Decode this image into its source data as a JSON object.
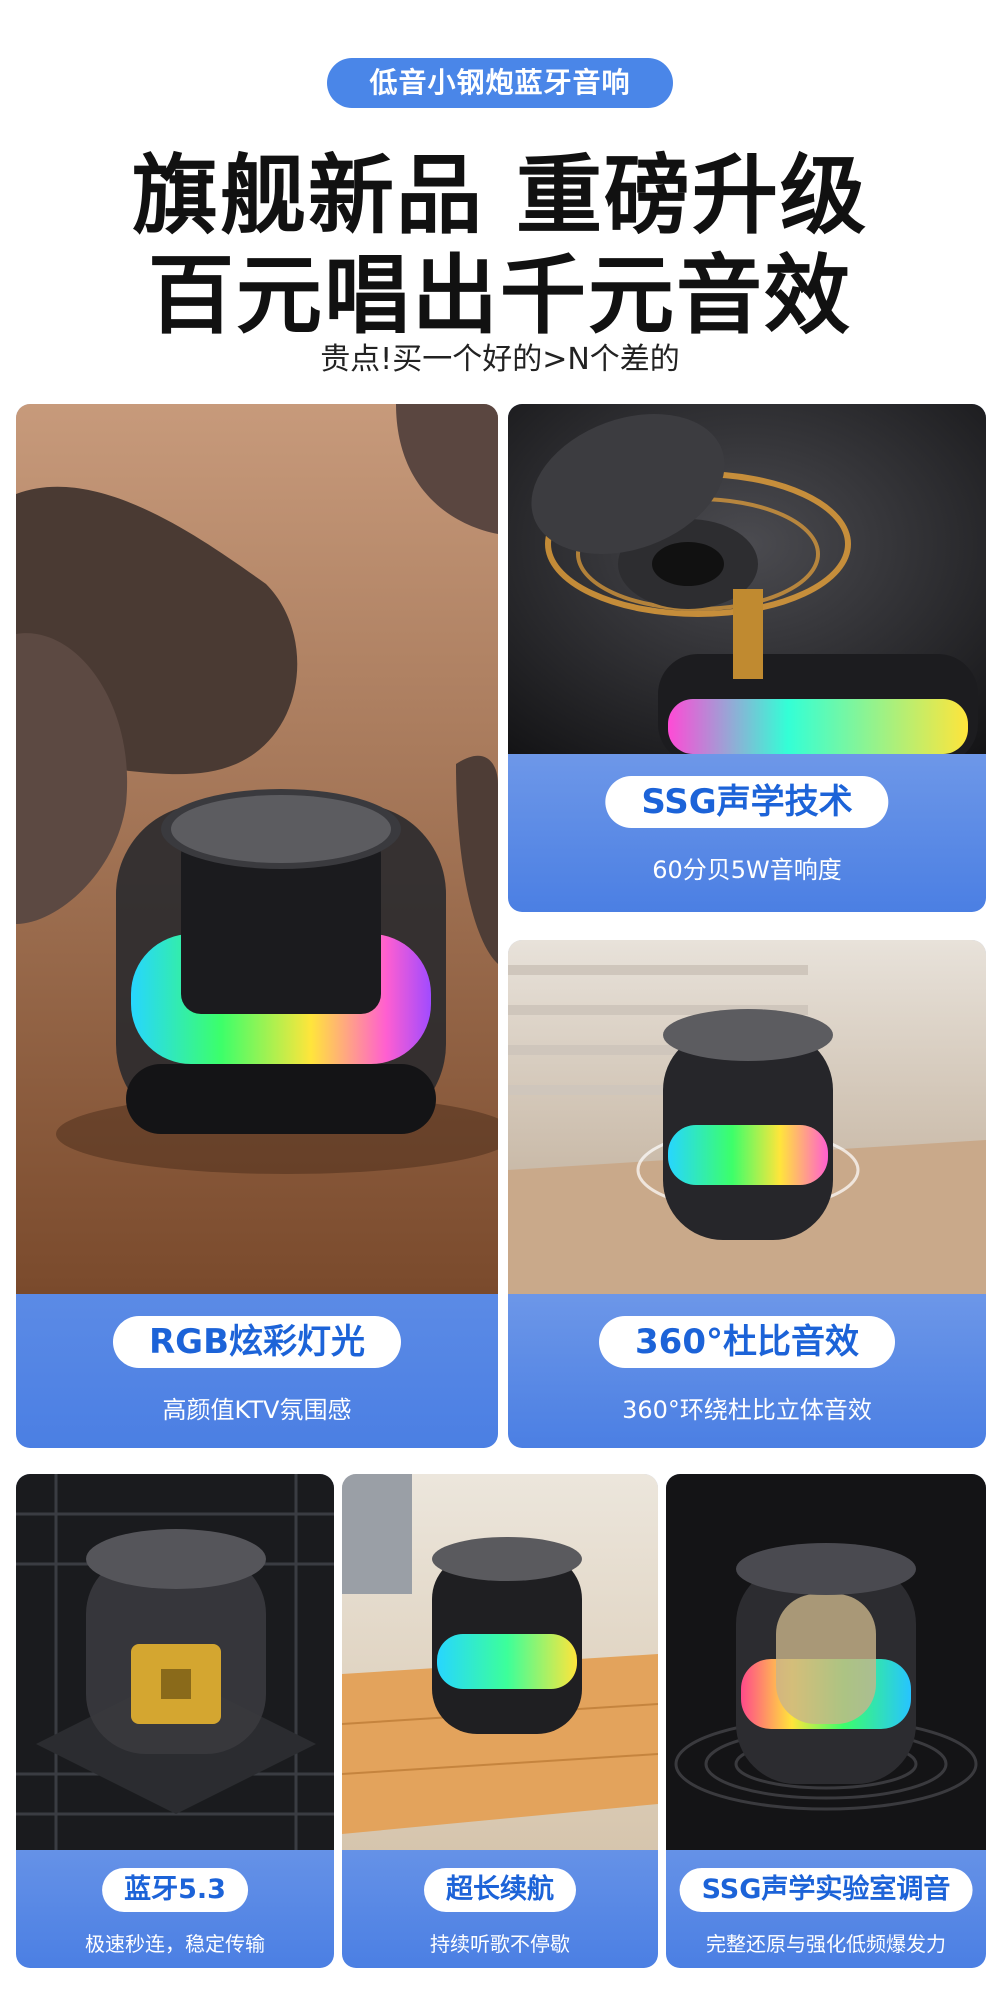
{
  "header": {
    "badge": "低音小钢炮蓝牙音响",
    "headline_line1": "旗舰新品 重磅升级",
    "headline_line2": "百元唱出千元音效",
    "tagline": "贵点!买一个好的>N个差的"
  },
  "features": [
    {
      "title": "RGB炫彩灯光",
      "subtitle": "高颜值KTV氛围感"
    },
    {
      "title": "SSG声学技术",
      "subtitle": "60分贝5W音响度"
    },
    {
      "title": "360°杜比音效",
      "subtitle": "360°环绕杜比立体音效"
    },
    {
      "title": "蓝牙5.3",
      "subtitle": "极速秒连，稳定传输"
    },
    {
      "title": "超长续航",
      "subtitle": "持续听歌不停歇"
    },
    {
      "title": "SSG声学实验室调音",
      "subtitle": "完整还原与强化低频爆发力"
    }
  ],
  "colors": {
    "accent": "#4a86e8",
    "label_text": "#1c63d8"
  }
}
